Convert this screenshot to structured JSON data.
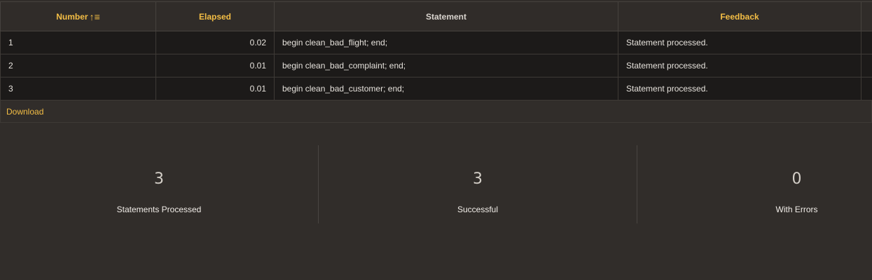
{
  "table": {
    "columns": [
      {
        "label": "Number",
        "sortable": true,
        "highlighted": true
      },
      {
        "label": "Elapsed",
        "highlighted": true
      },
      {
        "label": "Statement",
        "highlighted": false
      },
      {
        "label": "Feedback",
        "highlighted": true
      }
    ],
    "rows": [
      {
        "number": "1",
        "elapsed": "0.02",
        "statement": "begin clean_bad_flight; end;",
        "feedback": "Statement processed."
      },
      {
        "number": "2",
        "elapsed": "0.01",
        "statement": "begin clean_bad_complaint; end;",
        "feedback": "Statement processed."
      },
      {
        "number": "3",
        "elapsed": "0.01",
        "statement": "begin clean_bad_customer; end;",
        "feedback": "Statement processed."
      }
    ]
  },
  "footer": {
    "download_label": "Download"
  },
  "summary": [
    {
      "value": "3",
      "label": "Statements Processed"
    },
    {
      "value": "3",
      "label": "Successful"
    },
    {
      "value": "0",
      "label": "With Errors"
    }
  ],
  "colors": {
    "accent": "#f4be45",
    "background": "#312d2a",
    "row_background": "#1c1a19"
  },
  "icons": {
    "sort": "sort-ascending-icon"
  }
}
